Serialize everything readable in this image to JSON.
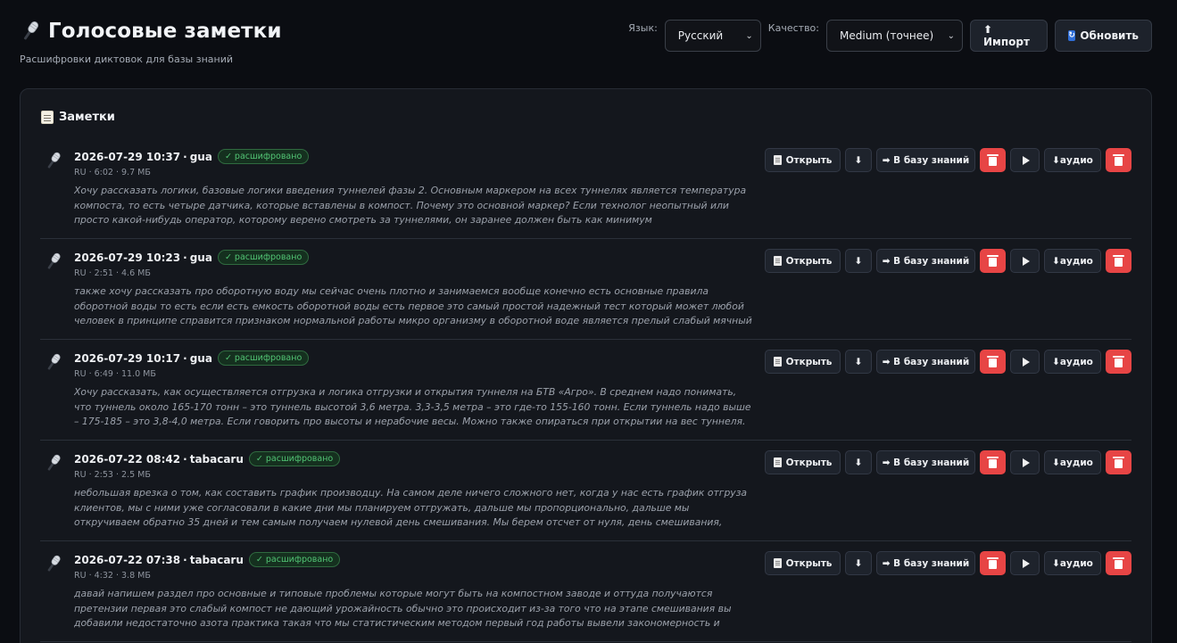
{
  "header": {
    "title": "Голосовые заметки",
    "subtitle": "Расшифровки диктовок для базы знаний",
    "title_icon": "microphone-icon"
  },
  "controls": {
    "language_label": "Язык:",
    "language_value": "Русский",
    "quality_label": "Качество:",
    "quality_value": "Medium (точнее)",
    "import_label": "⬆ Импорт",
    "refresh_label": "Обновить"
  },
  "panel": {
    "title": "Заметки"
  },
  "notes": [
    {
      "date": "2026-07-29 10:37",
      "author": "gua",
      "status": "✓ расшифровано",
      "meta": "RU · 6:02 · 9.7 МБ",
      "excerpt": "Хочу рассказать логики, базовые логики введения туннелей фазы 2. Основным маркером на всех туннелях является температура компоста, то есть четыре датчика, которые вставлены в компост. Почему это основной маркер? Если технолог неопытный или просто какой-нибудь оператор, которому верено смотреть за туннелями, он заранее должен быть как минимум проинструктирован, то так, чтобы он не..."
    },
    {
      "date": "2026-07-29 10:23",
      "author": "gua",
      "status": "✓ расшифровано",
      "meta": "RU · 2:51 · 4.6 МБ",
      "excerpt": "также хочу рассказать про оборотную воду мы сейчас очень плотно и занимаемся вообще конечно есть основные правила оборотной воды то есть если есть емкость оборотной воды есть первое это самый простой надежный тест который может любой человек в принципе справится признаком нормальной работы микро организму в оборотной воде является прелый слабый мячный запах если запах тухлых яиц..."
    },
    {
      "date": "2026-07-29 10:17",
      "author": "gua",
      "status": "✓ расшифровано",
      "meta": "RU · 6:49 · 11.0 МБ",
      "excerpt": "Хочу рассказать, как осуществляется отгрузка и логика отгрузки и открытия туннеля на БТВ «Агро». В среднем надо понимать, что туннель около 165-170 тонн – это туннель высотой 3,6 метра. 3,3-3,5 метра – это где-то 155-160 тонн. Если туннель надо выше – 175-185 – это 3,8-4,0 метра. Если говорить про высоты и нерабочие весы. Можно также опираться при открытии на вес туннеля. Допустим, если план открытия в..."
    },
    {
      "date": "2026-07-22 08:42",
      "author": "tabacaru",
      "status": "✓ расшифровано",
      "meta": "RU · 2:53 · 2.5 МБ",
      "excerpt": "небольшая врезка о том, как составить график производцу. На самом деле ничего сложного нет, когда у нас есть график отгруза клиентов, мы с ними уже согласовали в какие дни мы планируем отгружать, дальше мы пропорционально, дальше мы откручиваем обратно 35 дней и тем самым получаем нулевой день смешивания. Мы берем отсчет от нуля, день смешивания, длина смешивания, это нулевой день. Все, что..."
    },
    {
      "date": "2026-07-22 07:38",
      "author": "tabacaru",
      "status": "✓ расшифровано",
      "meta": "RU · 4:32 · 3.8 МБ",
      "excerpt": "давай напишем раздел про основные и типовые проблемы которые могут быть на компостном заводе и оттуда получаются претензии первая это слабый компост не дающий урожайность обычно это происходит из-за того что на этапе смешивания вы добавили недостаточно азота практика такая что мы статистическим методом первый год работы вывели закономерность и посмотрели при каком уровне азота наш клие..."
    }
  ],
  "actions": {
    "open": "Открыть",
    "download": "⬇",
    "to_kb": "➡ В базу знаний",
    "audio": "⬇аудио"
  }
}
